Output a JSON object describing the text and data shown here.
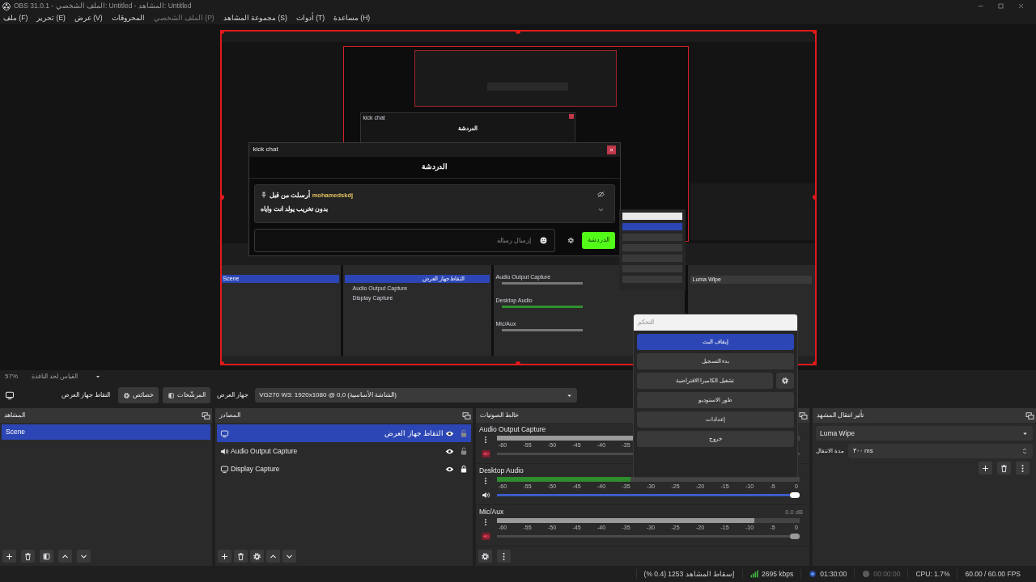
{
  "window": {
    "title": "OBS 31.0.1 - الملف الشخصي: Untitled - المشاهد: Untitled"
  },
  "menu": [
    {
      "label": "مساعدة (H)",
      "disabled": false
    },
    {
      "label": "أدوات (T)",
      "disabled": false
    },
    {
      "label": "مجموعة المشاهد (S)",
      "disabled": false
    },
    {
      "label": "الملف الشخصي (P)",
      "disabled": true
    },
    {
      "label": "المحروقات",
      "disabled": false
    },
    {
      "label": "عرض (V)",
      "disabled": false
    },
    {
      "label": "تحرير (E)",
      "disabled": false
    },
    {
      "label": "ملف (F)",
      "disabled": false
    }
  ],
  "preview": {
    "chat_window": {
      "title": "kick chat",
      "header": "الدردشة",
      "pinned": {
        "by_text": "أرسلت من قبل",
        "author": "mohamedskdj",
        "message": "بدون تخريب يولد انت واياه"
      },
      "input": {
        "placeholder": "إرسال رسالة"
      },
      "send_button": "الدردشة"
    },
    "nested_chat": {
      "title": "kick chat",
      "header": "الدردشة"
    },
    "mini_docks": {
      "scenes": [
        {
          "name": "Scene",
          "selected": true
        }
      ],
      "sources": [
        {
          "name": "التقاط جهاز العرض",
          "selected": true
        },
        {
          "name": "Audio Output Capture",
          "selected": false
        },
        {
          "name": "Display Capture",
          "selected": false
        }
      ],
      "mixer": [
        "Audio Output Capture",
        "Desktop Audio",
        "Mic/Aux"
      ],
      "transition": "Luma Wipe"
    }
  },
  "zoom": {
    "value": "57%",
    "scale_mode": "القياس لحد النافذة"
  },
  "source_toolbar": {
    "source_label": "التقاط جهاز العرض",
    "properties_button": "خصائص",
    "filters_button": "المرشّحات",
    "display_label": "جهاز العرض",
    "display": "VG270 W3: 1920x1080 @ 0,0 (الشاشة الأساسية)"
  },
  "scenes": {
    "title": "المشاهد",
    "items": [
      {
        "name": "Scene",
        "selected": true
      }
    ]
  },
  "sources": {
    "title": "المصادر",
    "items": [
      {
        "name": "التقاط جهاز العرض",
        "kind": "display",
        "selected": true,
        "visible": true,
        "locked": false
      },
      {
        "name": "Audio Output Capture",
        "kind": "audio",
        "selected": false,
        "visible": true,
        "locked": false
      },
      {
        "name": "Display Capture",
        "kind": "display",
        "selected": false,
        "visible": true,
        "locked": true
      }
    ]
  },
  "mixer": {
    "title": "خالط الصوتيات",
    "channels": [
      {
        "name": "Audio Output Capture",
        "muted": true,
        "meter": {
          "level": 0.6
        },
        "ticks": [
          "-35",
          "-40",
          "-45",
          "-50",
          "-55",
          "-60"
        ]
      },
      {
        "name": "Desktop Audio",
        "muted": false,
        "meter": {
          "level": 0.44
        },
        "volume": {
          "level": 1
        },
        "ticks": [
          "0",
          "-5",
          "-10",
          "-15",
          "-20",
          "-25",
          "-30",
          "-35",
          "-40",
          "-45",
          "-50",
          "-55",
          "-60"
        ]
      },
      {
        "name": "Mic/Aux",
        "muted": true,
        "reading": "0.0 dB",
        "meter": {
          "level": 0.85
        },
        "volume": {
          "level": 1
        },
        "ticks": [
          "0",
          "-5",
          "-10",
          "-15",
          "-20",
          "-25",
          "-30",
          "-35",
          "-40",
          "-45",
          "-50",
          "-55",
          "-60"
        ]
      }
    ]
  },
  "transitions": {
    "title": "تأثير انتقال المشهد",
    "transition": "Luma Wipe",
    "duration_label": "مدة الانتقال",
    "duration": "٣٠٠ ms"
  },
  "controls": {
    "title": "التحكم",
    "buttons": [
      {
        "label": "إيقاف البث",
        "kind": "plain",
        "active": true
      },
      {
        "label": "بدء التسجيل",
        "kind": "plain",
        "active": false
      },
      {
        "label": "تشغيل الكاميرا الافتراضية",
        "kind": "with_settings",
        "active": false
      },
      {
        "label": "طور الاستوديو",
        "kind": "plain",
        "active": false
      },
      {
        "label": "إعدادات",
        "kind": "plain",
        "active": false
      },
      {
        "label": "خروج",
        "kind": "plain",
        "active": false
      }
    ]
  },
  "status_bar": [
    {
      "kind": "fps",
      "text": "60.00 / 60.00 FPS"
    },
    {
      "kind": "cpu",
      "text": "CPU: 1.7%"
    },
    {
      "kind": "record",
      "text": "00:00:00",
      "on": false
    },
    {
      "kind": "live",
      "text": "01:30:00",
      "on": true
    },
    {
      "kind": "bitrate",
      "text": "2695 kbps"
    },
    {
      "kind": "dropped",
      "text": "إسقاط المشاهد 1253 (0.4 %)"
    }
  ]
}
